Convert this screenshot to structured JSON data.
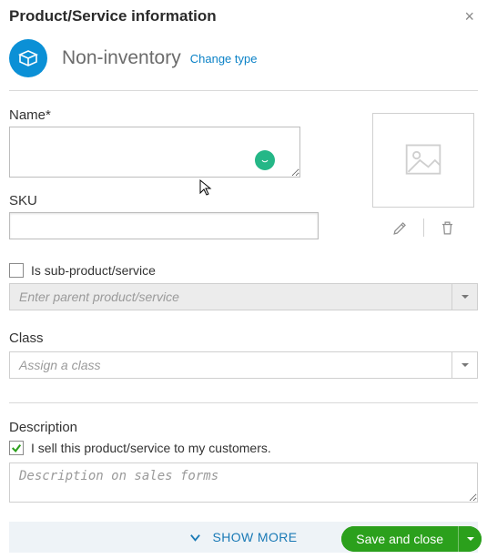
{
  "header": {
    "title": "Product/Service information",
    "close_label": "×"
  },
  "type": {
    "name": "Non-inventory",
    "change_link": "Change type",
    "icon": "box-icon"
  },
  "fields": {
    "name_label": "Name*",
    "name_value": "",
    "sku_label": "SKU",
    "sku_value": "",
    "sub_product_label": "Is sub-product/service",
    "sub_product_checked": false,
    "parent_placeholder": "Enter parent product/service",
    "class_label": "Class",
    "class_placeholder": "Assign a class"
  },
  "description": {
    "section_label": "Description",
    "sell_checkbox_label": "I sell this product/service to my customers.",
    "sell_checked": true,
    "sales_placeholder": "Description on sales forms"
  },
  "show_more_label": "SHOW MORE",
  "footer": {
    "save_label": "Save and close"
  },
  "image_panel": {
    "edit_icon": "pencil-icon",
    "delete_icon": "trash-icon",
    "placeholder_icon": "image-placeholder-icon"
  }
}
